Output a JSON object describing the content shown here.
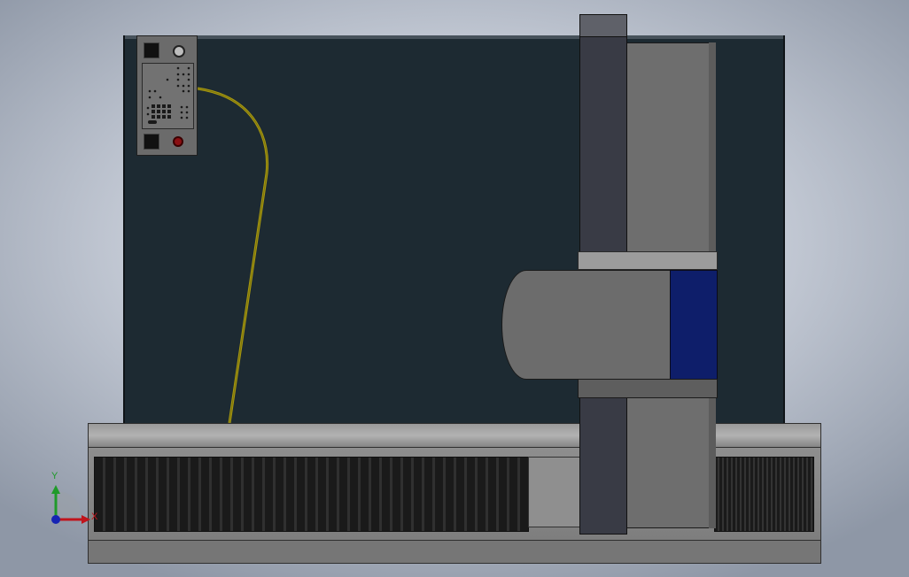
{
  "scene": {
    "description_type": "cad-viewport",
    "colors": {
      "enclosure": "#1d2a32",
      "cable": "#a89a10",
      "spindle_band": "#0e1e6a",
      "estop": "#8a0f12",
      "axis_x": "#c0141c",
      "axis_y": "#1f9a2a",
      "axis_origin": "#1624b4"
    }
  },
  "triad": {
    "x_label": "X",
    "y_label": "Y"
  },
  "icons": {
    "triad": "coordinate-axes-icon",
    "estop": "emergency-stop-icon",
    "knob": "rotary-knob-icon"
  }
}
